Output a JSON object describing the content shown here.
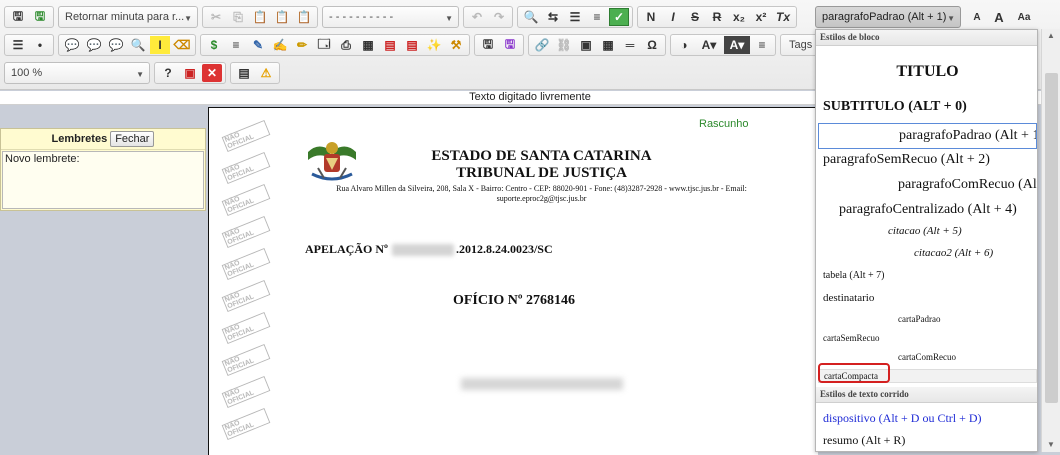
{
  "toolbar": {
    "minuta_combo": "Retornar minuta para r...",
    "dashes_combo": "- - - - - - - - - -",
    "style_combo": "paragrafoPadrao (Alt + 1)",
    "zoom_combo": "100 %",
    "tags_label": "Tags",
    "format": {
      "bold": "N",
      "italic": "I",
      "strike": "S",
      "strike2": "R",
      "sub": "x₂",
      "sup": "x²",
      "clear": "Tx"
    },
    "case_small": "A",
    "case_large": "A",
    "case_aa": "Aa",
    "omega": "Ω"
  },
  "subbar": {
    "text": "Texto digitado livremente"
  },
  "lembretes": {
    "title": "Lembretes",
    "close_label": "Fechar",
    "text": "Novo lembrete:"
  },
  "document": {
    "draft_label": "Rascunho",
    "stamp_text": "NÃO OFICIAL",
    "state_line": "ESTADO DE SANTA CATARINA",
    "court_line": "TRIBUNAL DE JUSTIÇA",
    "address_line1": "Rua Alvaro Millen da Silveira, 208, Sala X - Bairro: Centro - CEP: 88020-901 - Fone: (48)3287-2928 - www.tjsc.jus.br - Email:",
    "address_line2": "suporte.eproc2g@tjsc.jus.br",
    "appeal_prefix": "APELAÇÃO Nº",
    "appeal_suffix": ".2012.8.24.0023/SC",
    "office_line": "OFÍCIO Nº 2768146"
  },
  "style_menu": {
    "block_header": "Estilos de bloco",
    "inline_header": "Estilos de texto corrido",
    "items": {
      "titulo": "TITULO",
      "subtitulo": "SUBTITULO (ALT + 0)",
      "paragrafoPadrao": "paragrafoPadrao (Alt + 1)",
      "paragrafoSemRecuo": "paragrafoSemRecuo (Alt + 2)",
      "paragrafoComRecuo": "paragrafoComRecuo (Alt + 3)",
      "paragrafoCentralizado": "paragrafoCentralizado (Alt + 4)",
      "citacao": "citacao (Alt + 5)",
      "citacao2": "citacao2 (Alt + 6)",
      "tabela": "tabela (Alt + 7)",
      "destinatario": "destinatario",
      "cartaPadrao": "cartaPadrao",
      "cartaSemRecuo": "cartaSemRecuo",
      "cartaComRecuo": "cartaComRecuo",
      "cartaCompacta": "cartaCompacta",
      "dispositivo": "dispositivo (Alt + D ou Ctrl + D)",
      "resumo": "resumo (Alt + R)"
    },
    "colors": {
      "dispositivo": "#1f2bd6",
      "highlight": "#d42020"
    }
  }
}
